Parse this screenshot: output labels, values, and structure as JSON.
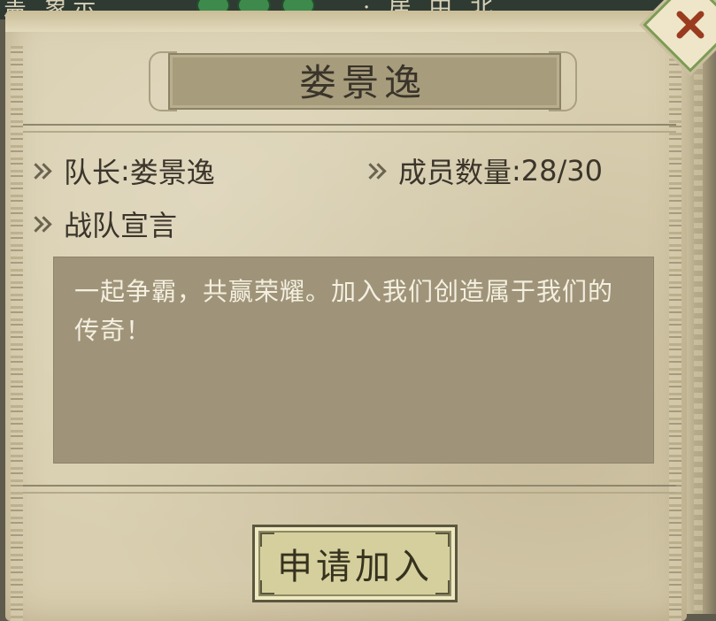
{
  "background": {
    "snippet_left": "盖 象示",
    "snippet_right": "· 居 中 北"
  },
  "panel": {
    "title": "娄景逸"
  },
  "info": {
    "captain_label": "队长",
    "separator": ":",
    "captain_name": "娄景逸",
    "members_label": "成员数量",
    "members_count": "28/30",
    "declaration_label": "战队宣言"
  },
  "declaration": {
    "text": "一起争霸，共赢荣耀。加入我们创造属于我们的传奇！"
  },
  "actions": {
    "join_label": "申请加入"
  },
  "colors": {
    "parchment": "#d9cfb0",
    "title_plate": "#a79c7c",
    "declaration_box": "#9f9479",
    "button_fill": "#d5cf9d",
    "close_accent": "#7d9b55",
    "close_x": "#9a3b1f",
    "text_dark": "#3b352b"
  },
  "icons": {
    "close": "close-icon",
    "bullet": "double-chevron-right-icon"
  }
}
